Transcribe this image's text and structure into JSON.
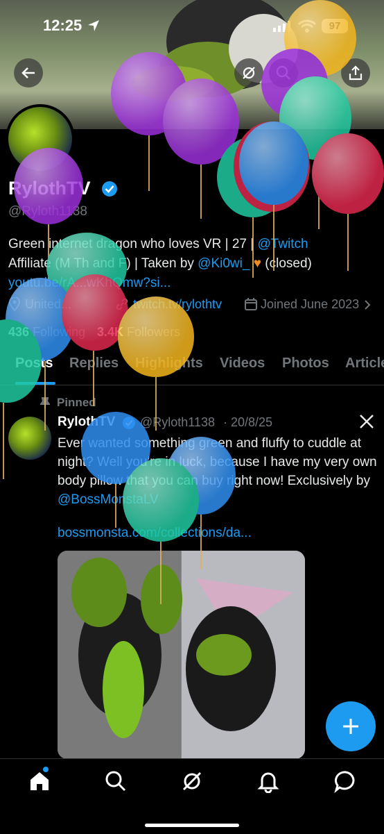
{
  "status_bar": {
    "time": "12:25",
    "battery": "97"
  },
  "profile": {
    "display_name": "RylothTV",
    "handle": "@Ryloth1138",
    "bio_line1_a": "Green internet dragon who loves VR | 27 | ",
    "bio_line1_link": "@Twitch",
    "bio_line2_a": "Affiliate (M Th and F) | Taken by ",
    "bio_line2_link": "@Ki0wi_",
    "bio_line2_b": " (closed)",
    "bio_line3_link": "youtu.be/rA...wKhQmw?si...",
    "location": "United...",
    "website": "twitch.tv/rylothtv",
    "joined": "Joined June 2023",
    "following_count": "436",
    "following_label": "Following",
    "followers_count": "3.4K",
    "followers_label": "Followers"
  },
  "tabs": [
    "Posts",
    "Replies",
    "Highlights",
    "Videos",
    "Photos",
    "Articles"
  ],
  "pinned": {
    "label": "Pinned",
    "author": "RylothTV",
    "handle": "@Ryloth1138",
    "date": "· 20/8/25",
    "text": "Ever wanted something green and fluffy to cuddle at night? Well you're in luck, because I have my very own body pillow that you can buy right now! Exclusively by ",
    "text_link": "@BossMonstaLV",
    "url": "bossmonsta.com/collections/da..."
  },
  "colors": {
    "accent": "#1d9bf0",
    "background": "#000000"
  },
  "icons": [
    "back-arrow-icon",
    "grok-icon",
    "search-icon",
    "share-icon",
    "location-icon",
    "link-icon",
    "calendar-icon",
    "pin-icon",
    "x-logo-icon",
    "plus-icon",
    "home-icon",
    "explore-icon",
    "grok-icon",
    "bell-icon",
    "messages-icon"
  ]
}
